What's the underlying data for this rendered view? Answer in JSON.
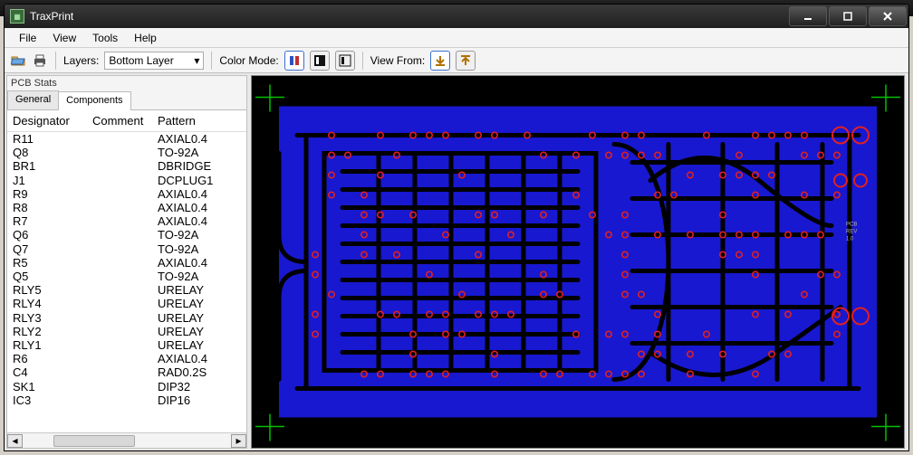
{
  "window": {
    "title": "TraxPrint"
  },
  "menubar": [
    "File",
    "View",
    "Tools",
    "Help"
  ],
  "toolbar": {
    "layers_label": "Layers:",
    "layers_value": "Bottom Layer",
    "colormode_label": "Color Mode:",
    "viewfrom_label": "View From:"
  },
  "sidepanel": {
    "title": "PCB Stats",
    "tabs": [
      "General",
      "Components"
    ],
    "active_tab": 1,
    "columns": {
      "d": "Designator",
      "c": "Comment",
      "p": "Pattern"
    },
    "rows": [
      {
        "d": "R11",
        "c": "",
        "p": "AXIAL0.4"
      },
      {
        "d": "Q8",
        "c": "",
        "p": "TO-92A"
      },
      {
        "d": "BR1",
        "c": "",
        "p": "DBRIDGE"
      },
      {
        "d": "J1",
        "c": "",
        "p": "DCPLUG1"
      },
      {
        "d": "R9",
        "c": "",
        "p": "AXIAL0.4"
      },
      {
        "d": "R8",
        "c": "",
        "p": "AXIAL0.4"
      },
      {
        "d": "R7",
        "c": "",
        "p": "AXIAL0.4"
      },
      {
        "d": "Q6",
        "c": "",
        "p": "TO-92A"
      },
      {
        "d": "Q7",
        "c": "",
        "p": "TO-92A"
      },
      {
        "d": "R5",
        "c": "",
        "p": "AXIAL0.4"
      },
      {
        "d": "Q5",
        "c": "",
        "p": "TO-92A"
      },
      {
        "d": "RLY5",
        "c": "",
        "p": "URELAY"
      },
      {
        "d": "RLY4",
        "c": "",
        "p": "URELAY"
      },
      {
        "d": "RLY3",
        "c": "",
        "p": "URELAY"
      },
      {
        "d": "RLY2",
        "c": "",
        "p": "URELAY"
      },
      {
        "d": "RLY1",
        "c": "",
        "p": "URELAY"
      },
      {
        "d": "R6",
        "c": "",
        "p": "AXIAL0.4"
      },
      {
        "d": "C4",
        "c": "",
        "p": "RAD0.2S"
      },
      {
        "d": "SK1",
        "c": "",
        "p": "DIP32"
      },
      {
        "d": "IC3",
        "c": "",
        "p": "DIP16"
      }
    ]
  }
}
